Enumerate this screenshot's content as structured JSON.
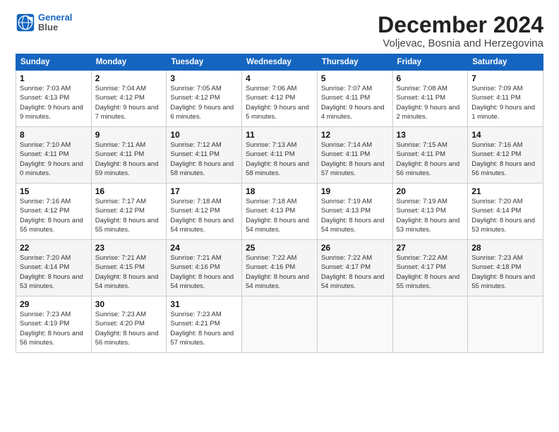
{
  "header": {
    "logo_line1": "General",
    "logo_line2": "Blue",
    "title": "December 2024",
    "subtitle": "Voljevac, Bosnia and Herzegovina"
  },
  "weekdays": [
    "Sunday",
    "Monday",
    "Tuesday",
    "Wednesday",
    "Thursday",
    "Friday",
    "Saturday"
  ],
  "weeks": [
    [
      {
        "day": "1",
        "sunrise": "7:03 AM",
        "sunset": "4:13 PM",
        "daylight": "9 hours and 9 minutes."
      },
      {
        "day": "2",
        "sunrise": "7:04 AM",
        "sunset": "4:12 PM",
        "daylight": "9 hours and 7 minutes."
      },
      {
        "day": "3",
        "sunrise": "7:05 AM",
        "sunset": "4:12 PM",
        "daylight": "9 hours and 6 minutes."
      },
      {
        "day": "4",
        "sunrise": "7:06 AM",
        "sunset": "4:12 PM",
        "daylight": "9 hours and 5 minutes."
      },
      {
        "day": "5",
        "sunrise": "7:07 AM",
        "sunset": "4:11 PM",
        "daylight": "9 hours and 4 minutes."
      },
      {
        "day": "6",
        "sunrise": "7:08 AM",
        "sunset": "4:11 PM",
        "daylight": "9 hours and 2 minutes."
      },
      {
        "day": "7",
        "sunrise": "7:09 AM",
        "sunset": "4:11 PM",
        "daylight": "9 hours and 1 minute."
      }
    ],
    [
      {
        "day": "8",
        "sunrise": "7:10 AM",
        "sunset": "4:11 PM",
        "daylight": "9 hours and 0 minutes."
      },
      {
        "day": "9",
        "sunrise": "7:11 AM",
        "sunset": "4:11 PM",
        "daylight": "8 hours and 59 minutes."
      },
      {
        "day": "10",
        "sunrise": "7:12 AM",
        "sunset": "4:11 PM",
        "daylight": "8 hours and 58 minutes."
      },
      {
        "day": "11",
        "sunrise": "7:13 AM",
        "sunset": "4:11 PM",
        "daylight": "8 hours and 58 minutes."
      },
      {
        "day": "12",
        "sunrise": "7:14 AM",
        "sunset": "4:11 PM",
        "daylight": "8 hours and 57 minutes."
      },
      {
        "day": "13",
        "sunrise": "7:15 AM",
        "sunset": "4:11 PM",
        "daylight": "8 hours and 56 minutes."
      },
      {
        "day": "14",
        "sunrise": "7:16 AM",
        "sunset": "4:12 PM",
        "daylight": "8 hours and 56 minutes."
      }
    ],
    [
      {
        "day": "15",
        "sunrise": "7:16 AM",
        "sunset": "4:12 PM",
        "daylight": "8 hours and 55 minutes."
      },
      {
        "day": "16",
        "sunrise": "7:17 AM",
        "sunset": "4:12 PM",
        "daylight": "8 hours and 55 minutes."
      },
      {
        "day": "17",
        "sunrise": "7:18 AM",
        "sunset": "4:12 PM",
        "daylight": "8 hours and 54 minutes."
      },
      {
        "day": "18",
        "sunrise": "7:18 AM",
        "sunset": "4:13 PM",
        "daylight": "8 hours and 54 minutes."
      },
      {
        "day": "19",
        "sunrise": "7:19 AM",
        "sunset": "4:13 PM",
        "daylight": "8 hours and 54 minutes."
      },
      {
        "day": "20",
        "sunrise": "7:19 AM",
        "sunset": "4:13 PM",
        "daylight": "8 hours and 53 minutes."
      },
      {
        "day": "21",
        "sunrise": "7:20 AM",
        "sunset": "4:14 PM",
        "daylight": "8 hours and 53 minutes."
      }
    ],
    [
      {
        "day": "22",
        "sunrise": "7:20 AM",
        "sunset": "4:14 PM",
        "daylight": "8 hours and 53 minutes."
      },
      {
        "day": "23",
        "sunrise": "7:21 AM",
        "sunset": "4:15 PM",
        "daylight": "8 hours and 54 minutes."
      },
      {
        "day": "24",
        "sunrise": "7:21 AM",
        "sunset": "4:16 PM",
        "daylight": "8 hours and 54 minutes."
      },
      {
        "day": "25",
        "sunrise": "7:22 AM",
        "sunset": "4:16 PM",
        "daylight": "8 hours and 54 minutes."
      },
      {
        "day": "26",
        "sunrise": "7:22 AM",
        "sunset": "4:17 PM",
        "daylight": "8 hours and 54 minutes."
      },
      {
        "day": "27",
        "sunrise": "7:22 AM",
        "sunset": "4:17 PM",
        "daylight": "8 hours and 55 minutes."
      },
      {
        "day": "28",
        "sunrise": "7:23 AM",
        "sunset": "4:18 PM",
        "daylight": "8 hours and 55 minutes."
      }
    ],
    [
      {
        "day": "29",
        "sunrise": "7:23 AM",
        "sunset": "4:19 PM",
        "daylight": "8 hours and 56 minutes."
      },
      {
        "day": "30",
        "sunrise": "7:23 AM",
        "sunset": "4:20 PM",
        "daylight": "8 hours and 56 minutes."
      },
      {
        "day": "31",
        "sunrise": "7:23 AM",
        "sunset": "4:21 PM",
        "daylight": "8 hours and 57 minutes."
      },
      null,
      null,
      null,
      null
    ]
  ],
  "labels": {
    "sunrise": "Sunrise: ",
    "sunset": "Sunset: ",
    "daylight": "Daylight: "
  }
}
